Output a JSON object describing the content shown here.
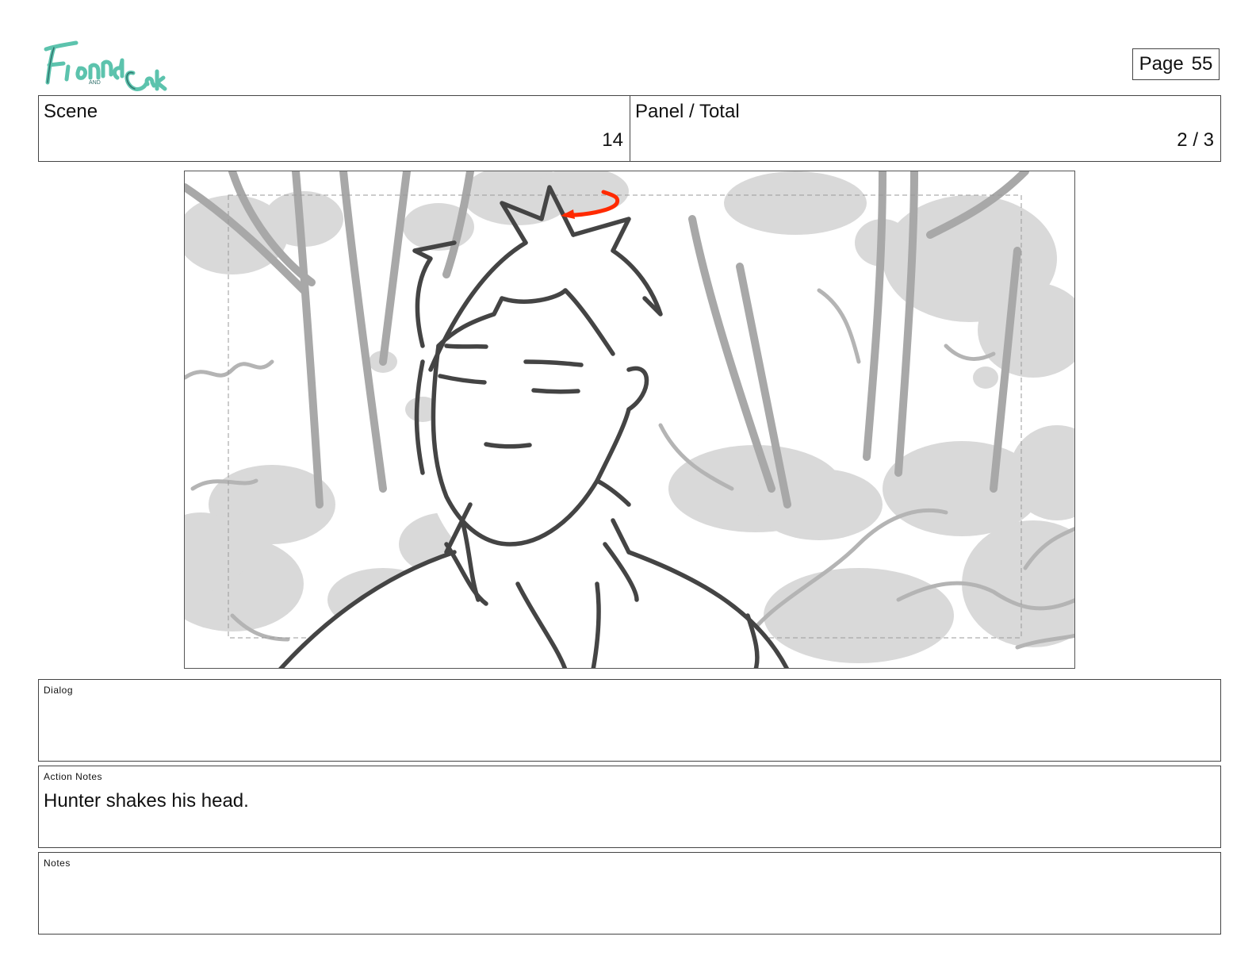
{
  "logo": {
    "text": "Fionna and Cake",
    "color": "#5cc3ad"
  },
  "page": {
    "label": "Page",
    "number": "55"
  },
  "header": {
    "scene_label": "Scene",
    "scene_value": "14",
    "panel_label": "Panel / Total",
    "panel_value": "2 / 3"
  },
  "panel_image": {
    "accent_color": "#ff2a00"
  },
  "dialog": {
    "label": "Dialog",
    "text": ""
  },
  "action_notes": {
    "label": "Action Notes",
    "text": "Hunter shakes his head."
  },
  "notes": {
    "label": "Notes",
    "text": ""
  }
}
